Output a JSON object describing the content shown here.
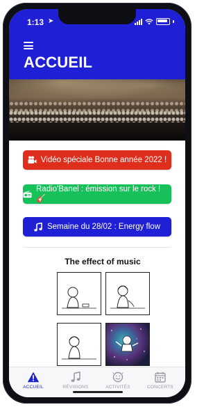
{
  "status_bar": {
    "time": "1:13"
  },
  "header": {
    "title": "ACCUEIL"
  },
  "buttons": [
    {
      "label": "Vidéo spéciale Bonne année 2022 !",
      "icon": "video-camera-icon",
      "color": "#e02e1c"
    },
    {
      "label": "Radio'Banel : émission sur le rock ! 🎸",
      "icon": "radio-icon",
      "color": "#17c15a"
    },
    {
      "label": "Semaine du 28/02 : Energy flow",
      "icon": "music-note-icon",
      "color": "#1f1fd6"
    }
  ],
  "comic": {
    "title": "The effect of music"
  },
  "tabs": [
    {
      "label": "ACCUEIL",
      "icon": "warning-triangle-icon",
      "active": true
    },
    {
      "label": "RÉVISIONS",
      "icon": "music-note-icon",
      "active": false
    },
    {
      "label": "ACTIVITÉS",
      "icon": "smiley-icon",
      "active": false
    },
    {
      "label": "CONCERTS",
      "icon": "calendar-icon",
      "active": false
    }
  ],
  "colors": {
    "accent": "#1f1fd6",
    "tab_inactive": "#9a9aa2"
  }
}
